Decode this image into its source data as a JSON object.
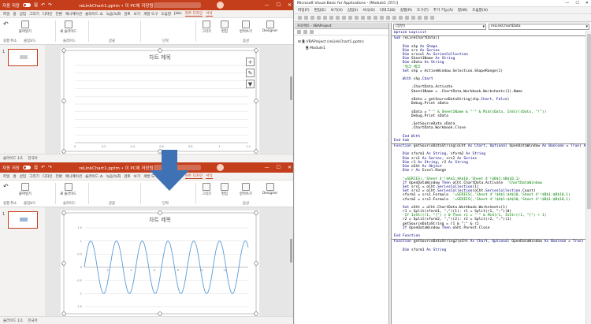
{
  "ppt_top": {
    "title": "자동 저장",
    "file": "reLinkChart1.pptm • 이 PC에 저장됨",
    "search_label": "",
    "tabs": [
      "파일",
      "홈",
      "삽입",
      "그리기",
      "디자인",
      "전환",
      "애니메이션",
      "슬라이드 쇼",
      "녹음/녹화",
      "검토",
      "보기",
      "개발 도구",
      "도움말",
      "Jobs",
      "차트 디자인",
      "서식"
    ],
    "active_tabs": [
      14,
      15
    ],
    "ribbon": {
      "paste": "붙여넣기",
      "clipboard": "클립보드",
      "slides": "슬라이드",
      "font": "글꼴",
      "paragraph": "단락",
      "drawing": "그리기",
      "editing": "편집",
      "dictate": "받아쓰기",
      "designer": "Designer",
      "voice": "음성",
      "new_slide": "새 슬라이드",
      "undo": "실행 취소"
    },
    "slide_number": "1",
    "chart_title": "차트 제목",
    "status": {
      "slide": "슬라이드 1/1",
      "lang": "한국어"
    }
  },
  "ppt_bottom": {
    "title": "자동 저장",
    "file": "reLinkChart1.pptm • 이 PC에 저장됨",
    "slide_number": "1",
    "chart_title": "차트 제목",
    "status": {
      "slide": "슬라이드 1/1",
      "lang": "한국어"
    }
  },
  "chart_data": [
    {
      "type": "line",
      "title": "차트 제목",
      "x": [
        0,
        0.2,
        0.4,
        0.6,
        0.8,
        1,
        1.2
      ],
      "y": [
        0,
        0,
        0,
        0,
        0,
        0,
        0
      ],
      "xlim": [
        0,
        1.2
      ],
      "ylim": [
        0,
        1
      ],
      "grid": true,
      "series": []
    },
    {
      "type": "line",
      "title": "차트 제목",
      "xlim": [
        0,
        14
      ],
      "ylim": [
        -1.5,
        1.5
      ],
      "yticks": [
        1.5,
        1,
        0.5,
        0,
        -0.5,
        -1,
        -1.5
      ],
      "xticks": [
        2,
        4,
        6,
        8,
        10,
        12
      ],
      "grid": true,
      "series": [
        {
          "function": "sin",
          "period": 2.2,
          "amplitude": 1,
          "color": "#5b9bd5"
        }
      ]
    }
  ],
  "vbe": {
    "title": "Microsoft Visual Basic for Applications - [Module1 (코드)]",
    "menu": [
      "파일(F)",
      "편집(E)",
      "보기(V)",
      "삽입(I)",
      "서식(O)",
      "디버그(D)",
      "실행(R)",
      "도구(T)",
      "추가 기능(A)",
      "창(W)",
      "도움말(H)"
    ],
    "project_title": "프로젝트 - VBAProject",
    "project_items": [
      "VBAProject (reLinkChart1.pptm)",
      "Module1"
    ],
    "dd_left": "(일반)",
    "dd_right": "reLinkChartData",
    "code": [
      "Option Explicit",
      "---",
      "Sub reLinkChartData()",
      "",
      "    Dim shp As Shape",
      "    Dim srs As Series",
      "    Dim srscol As SeriesCollection",
      "    Dim Sheet1Name As String",
      "    Dim sData As String",
      "    '워크 체크",
      "    Set shp = ActiveWindow.Selection.ShapeRange(1)",
      "",
      "    With shp.Chart",
      "",
      "        .ChartData.Activate",
      "        Sheet1Name = .ChartData.Workbook.Worksheets(1).Name",
      "",
      "        sData = getSourceDataString(shp.Chart, False)",
      "        Debug.Print sData",
      "",
      "        sData = \"'\" & Sheet1Name & \"'\" & Mid(sData, InStr(sData, \"!\"))",
      "        Debug.Print sData",
      "",
      "        .SetSourceData sData",
      "        .ChartData.Workbook.Close",
      "",
      "    End With",
      "End Sub",
      "---",
      "Function getSourceDataString(oCht As Chart, Optional OpenDataWindow As Boolean = True) As String",
      "",
      "    Dim sform1 As String, sform2 As String",
      "    Dim srs1 As Series, srs2 As Series",
      "    Dim r1 As String, r2 As String",
      "    Dim oSht As Object",
      "    Dim r As Excel.Range",
      "",
      "    '=SERIES(,'Sheet 4'!$A$1:$A$10,'Sheet 4'!$B$1:$B$10,1)",
      "    If OpenDataWindow Then oCht.ChartData.Activate  'ChartDataWindow",
      "    Set srs1 = oCht.SeriesCollection(1)",
      "    Set srs2 = oCht.SeriesCollection(oCht.SeriesCollection.Count)",
      "    sform1 = srs1.Formula  '=SERIES(,'Sheet 4'!$A$1:$A$10,'Sheet 4'!$B$1:$B$10,1)",
      "    sform2 = srs2.Formula  '=SERIES(,'Sheet 4'!$A$1:$A$10,'Sheet 4'!$B$1:$B$10,1)",
      "",
      "    Set oSht = oCht.ChartData.Workbook.Worksheets(1)",
      "    r1 = Split(sform1, \",\")(1): r1 = Split(r1, \":\")(0)",
      "    'If InStr(r1, \"]\") > 0 Then r1 = \"'\" & Mid(r1, InStr(r1, \"]\") + 1)",
      "    r2 = Split(sform2, \",\")(2): r2 = Split(r2, \":\")(1)",
      "    getSourceDataString = r1 & \":\" & r2",
      "    If OpenDataWindow Then oSht.Parent.Close",
      "",
      "End Function",
      "---",
      "Function getSourceDataString2(oCht As Chart, Optional OpenDataWindow As Boolean = True) As String",
      "",
      "    Dim sform1 As String"
    ]
  }
}
